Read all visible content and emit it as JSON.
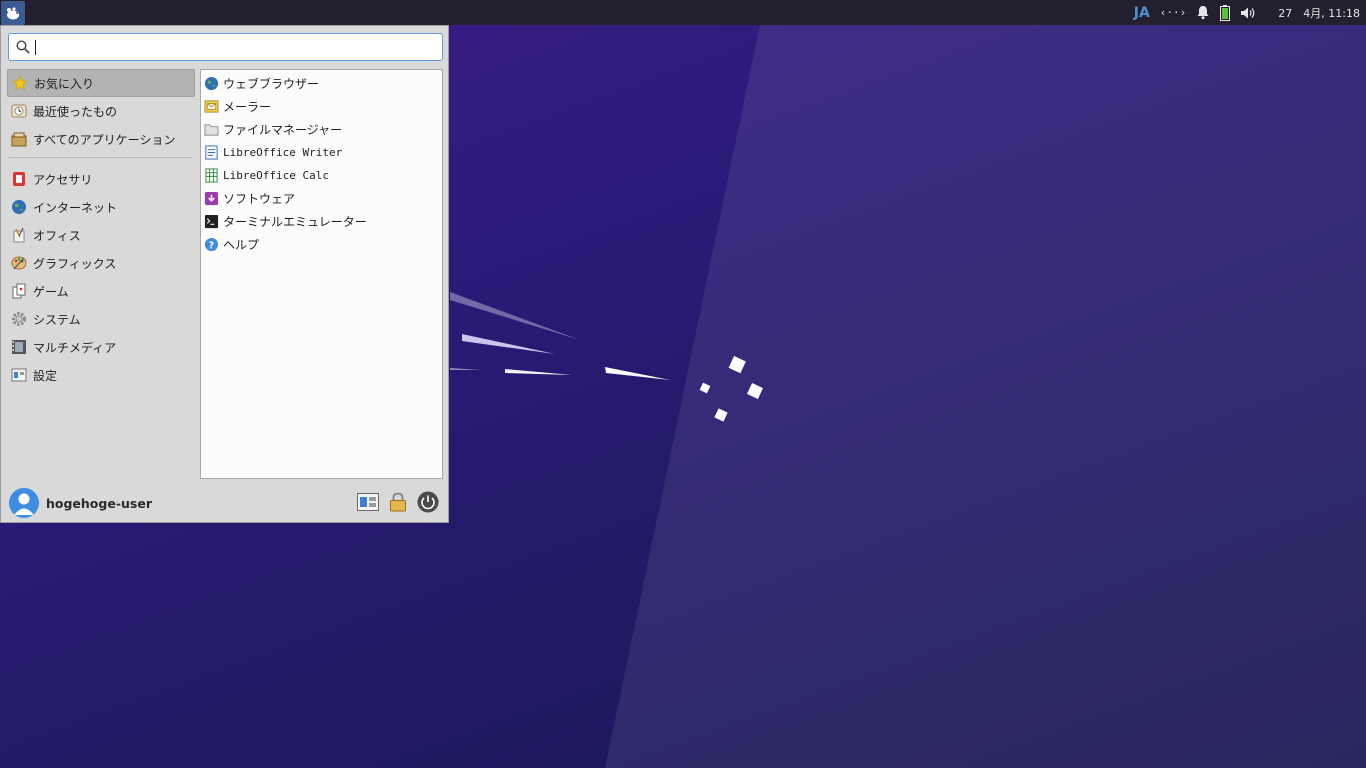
{
  "colors": {
    "panel_bg": "#241f2e",
    "menu_bg": "#d9d9d9",
    "accent": "#3d8ee0",
    "wallpaper_top": "#3e1e8a",
    "wallpaper_bottom": "#171552"
  },
  "panel": {
    "app_menu_icon": "xfce-mouse-icon",
    "language": "JA",
    "network_indicator": "‹··›",
    "notification_icon": "bell-icon",
    "battery_icon": "battery-icon",
    "volume_icon": "volume-icon",
    "clock": "27　4月, 11:18"
  },
  "menu": {
    "search": {
      "value": "",
      "placeholder": ""
    },
    "categories": [
      {
        "label": "お気に入り",
        "icon": "favorites-star-icon",
        "selected": true
      },
      {
        "label": "最近使ったもの",
        "icon": "recent-clock-icon"
      },
      {
        "label": "すべてのアプリケーション",
        "icon": "all-apps-icon"
      },
      {
        "label": "アクセサリ",
        "icon": "accessories-icon"
      },
      {
        "label": "インターネット",
        "icon": "internet-globe-icon"
      },
      {
        "label": "オフィス",
        "icon": "office-icon"
      },
      {
        "label": "グラフィックス",
        "icon": "graphics-palette-icon"
      },
      {
        "label": "ゲーム",
        "icon": "games-icon"
      },
      {
        "label": "システム",
        "icon": "system-gear-icon"
      },
      {
        "label": "マルチメディア",
        "icon": "multimedia-icon"
      },
      {
        "label": "設定",
        "icon": "settings-icon"
      }
    ],
    "apps": [
      {
        "label": "ウェブブラウザー",
        "icon": "web-browser-icon"
      },
      {
        "label": "メーラー",
        "icon": "mail-icon"
      },
      {
        "label": "ファイルマネージャー",
        "icon": "folder-icon"
      },
      {
        "label": "LibreOffice Writer",
        "icon": "writer-document-icon"
      },
      {
        "label": "LibreOffice Calc",
        "icon": "calc-spreadsheet-icon"
      },
      {
        "label": "ソフトウェア",
        "icon": "software-store-icon"
      },
      {
        "label": "ターミナルエミュレーター",
        "icon": "terminal-icon"
      },
      {
        "label": "ヘルプ",
        "icon": "help-icon"
      }
    ],
    "user": {
      "name": "hogehoge-user"
    }
  }
}
